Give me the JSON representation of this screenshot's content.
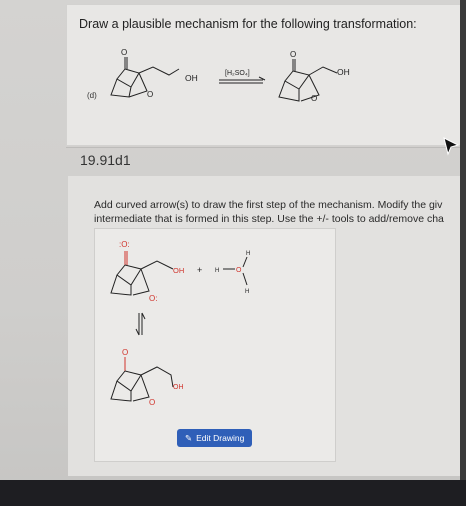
{
  "problem": {
    "prompt": "Draw a plausible mechanism for the following transformation:",
    "part_label": "(d)",
    "reactant_oh": "OH",
    "reagent": "[H₂SO₄]",
    "product_oh": "OH",
    "ketone_o": "O",
    "ring_o": "O"
  },
  "question": {
    "id": "19.91d1",
    "instruction_line1": "Add curved arrow(s) to draw the first step of the mechanism. Modify the giv",
    "instruction_line2": "intermediate that is formed in this step. Use the +/- tools to add/remove cha"
  },
  "drawing": {
    "top_carbonyl": ":O:",
    "top_oh": "OH",
    "plus": "+",
    "hydronium_h_left": "H",
    "hydronium_o": "O",
    "hydronium_h_top": "H",
    "hydronium_h_bottom": "H",
    "ring_o": "O:",
    "bottom_o": "O",
    "bottom_oh": "OH",
    "edit_label": "Edit Drawing"
  },
  "colors": {
    "accent": "#2f5fb8",
    "bond_red": "#d0342c"
  },
  "icons": [
    "pencil-icon",
    "cursor-arrow-icon",
    "equilibrium-arrow-icon"
  ]
}
